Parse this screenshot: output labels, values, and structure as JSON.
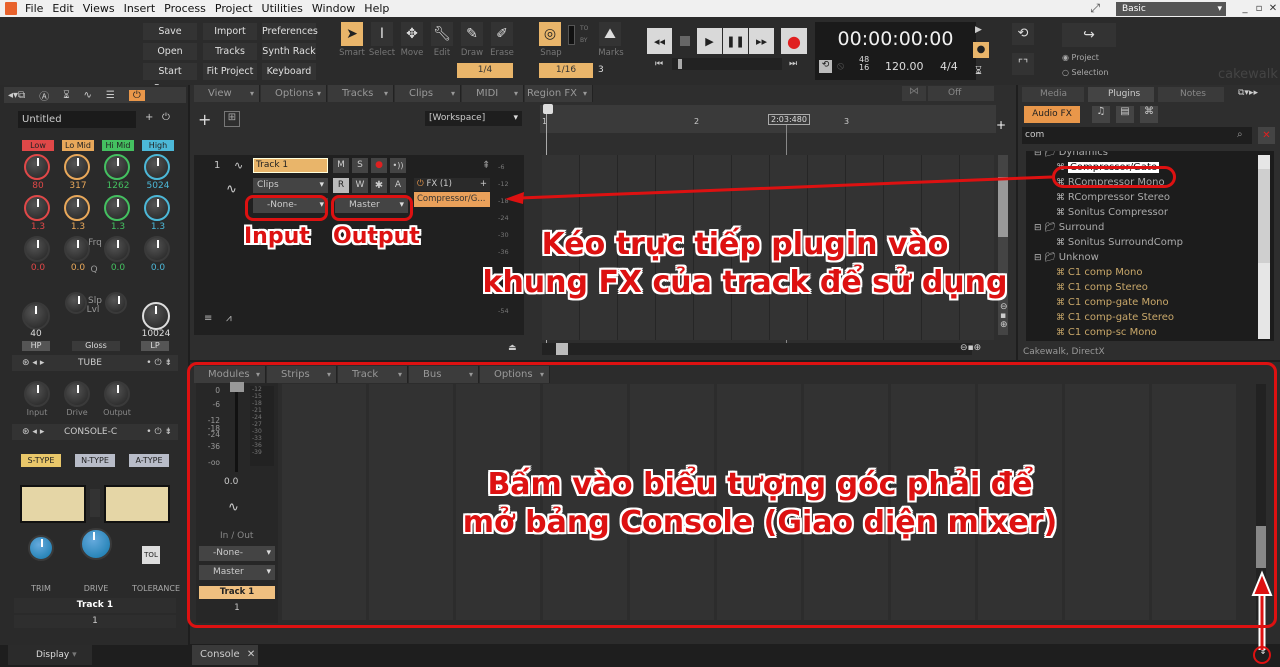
{
  "menubar": {
    "items": [
      "File",
      "Edit",
      "Views",
      "Insert",
      "Process",
      "Project",
      "Utilities",
      "Window",
      "Help"
    ],
    "workspace": "Basic"
  },
  "control_bar": {
    "buttons": [
      "Save",
      "Import",
      "Preferences",
      "Open",
      "Tracks",
      "Synth Rack",
      "Start Screen",
      "Fit Project",
      "Keyboard"
    ],
    "tools": [
      "Smart",
      "Select",
      "Move",
      "Edit",
      "Draw",
      "Erase"
    ],
    "snap_label": "Snap",
    "marks_label": "Marks",
    "snap_to": "TO",
    "snap_by": "BY",
    "tool_resolution": "1/4",
    "snap_resolution": "1/16",
    "snap_extra": "3",
    "time": "00:00:00:00",
    "sample_rate_top": "48",
    "sample_rate_bottom": "16",
    "tempo": "120.00",
    "meter": "4/4",
    "export_project": "Project",
    "export_selection": "Selection",
    "brand": "cakewalk"
  },
  "inspector": {
    "preset_name": "Untitled",
    "bands": [
      {
        "label": "Low",
        "color": "#e04848",
        "freq": "80",
        "q": "1.3",
        "lvl": "0.0"
      },
      {
        "label": "Lo Mid",
        "color": "#e9a85a",
        "freq": "317",
        "q": "1.3",
        "lvl": "0.0"
      },
      {
        "label": "Hi Mid",
        "color": "#44c060",
        "freq": "1262",
        "q": "1.3",
        "lvl": "0.0"
      },
      {
        "label": "High",
        "color": "#4cb8d8",
        "freq": "5024",
        "q": "1.3",
        "lvl": "0.0"
      }
    ],
    "row_labels": {
      "freq": "Frq",
      "q": "Q",
      "lvl": "Lvl",
      "slope": "Slp",
      "f": "F"
    },
    "hp_value": "40",
    "lp_value": "10024",
    "hp_label": "HP",
    "lp_label": "LP",
    "gloss_label": "Gloss",
    "tube_title": "TUBE",
    "tube_knobs": [
      "Input",
      "Drive",
      "Output"
    ],
    "console_title": "CONSOLE-C",
    "console_types": [
      "S-TYPE",
      "N-TYPE",
      "A-TYPE"
    ],
    "console_knobs": [
      "TRIM",
      "DRIVE",
      "TOLERANCE"
    ],
    "tol_label": "TOL",
    "track_name": "Track 1",
    "track_number": "1",
    "display_tab": "Display"
  },
  "trackview": {
    "menus": [
      "View",
      "Options",
      "Tracks",
      "Clips",
      "MIDI",
      "Region FX"
    ],
    "workspace": "[Workspace]",
    "snap_off": "Off",
    "ruler": [
      "1",
      "2",
      "3"
    ],
    "cursor_time": "2:03:480",
    "track": {
      "number": "1",
      "name": "Track 1",
      "buttons": [
        "M",
        "S",
        "R",
        "W",
        "A"
      ],
      "clips_label": "Clips",
      "input": "-None-",
      "output": "Master",
      "fx_header": "FX (1)",
      "fx_item": "Compressor/G..."
    },
    "meter_scale": [
      "-6",
      "-12",
      "-18",
      "-24",
      "-30",
      "-36",
      "-54"
    ]
  },
  "browser": {
    "tabs": [
      "Media",
      "Plugins",
      "Notes"
    ],
    "audio_fx": "Audio FX",
    "search_value": "com",
    "tree": [
      {
        "type": "folder",
        "label": "Dynamics"
      },
      {
        "type": "item",
        "label": "Compressor/Gate",
        "selected": true
      },
      {
        "type": "item",
        "label": "RCompressor Mono"
      },
      {
        "type": "item",
        "label": "RCompressor Stereo"
      },
      {
        "type": "item",
        "label": "Sonitus Compressor"
      },
      {
        "type": "folder",
        "label": "Surround"
      },
      {
        "type": "item",
        "label": "Sonitus SurroundComp"
      },
      {
        "type": "folder",
        "label": "Unknow"
      },
      {
        "type": "item",
        "label": "C1 comp Mono",
        "gold": true
      },
      {
        "type": "item",
        "label": "C1 comp Stereo",
        "gold": true
      },
      {
        "type": "item",
        "label": "C1 comp-gate Mono",
        "gold": true
      },
      {
        "type": "item",
        "label": "C1 comp-gate Stereo",
        "gold": true
      },
      {
        "type": "item",
        "label": "C1 comp-sc Mono",
        "gold": true
      }
    ],
    "status": "Cakewalk, DirectX"
  },
  "console": {
    "menus": [
      "Modules",
      "Strips",
      "Track",
      "Bus",
      "Options"
    ],
    "fader_scale": [
      "0",
      "-6",
      "-12",
      "-18",
      "-24",
      "-36",
      "-oo"
    ],
    "meter_scale": [
      "-12",
      "-15",
      "-18",
      "-21",
      "-24",
      "-27",
      "-30",
      "-33",
      "-36",
      "-39"
    ],
    "fader_value": "0.0",
    "inout_label": "In / Out",
    "input": "-None-",
    "output": "Master",
    "track_name": "Track 1",
    "track_number": "1",
    "tab_label": "Console"
  },
  "annotations": {
    "input": "Input",
    "output": "Output",
    "drag_line1": "Kéo trực tiếp plugin vào",
    "drag_line2": "khung FX của track để sử dụng",
    "console_line1": "Bấm vào biểu tượng góc phải để",
    "console_line2": "mở bảng Console (Giao diện mixer)"
  }
}
